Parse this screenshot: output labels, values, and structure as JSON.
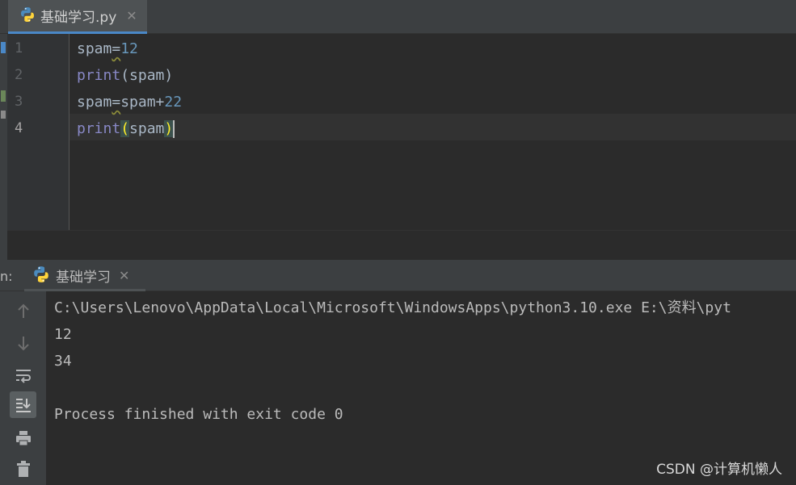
{
  "editor": {
    "tab": {
      "label": "基础学习.py",
      "close": "✕"
    },
    "line_numbers": [
      "1",
      "2",
      "3",
      "4"
    ],
    "lines": [
      [
        {
          "t": "name",
          "v": "spam"
        },
        {
          "t": "op",
          "v": "="
        },
        {
          "t": "num",
          "v": "12"
        }
      ],
      [
        {
          "t": "builtin",
          "v": "print"
        },
        {
          "t": "paren",
          "v": "("
        },
        {
          "t": "name",
          "v": "spam"
        },
        {
          "t": "paren",
          "v": ")"
        }
      ],
      [
        {
          "t": "name",
          "v": "spam"
        },
        {
          "t": "op",
          "v": "="
        },
        {
          "t": "name",
          "v": "spam+"
        },
        {
          "t": "num",
          "v": "22"
        }
      ],
      [
        {
          "t": "builtin",
          "v": "print"
        },
        {
          "t": "paren-hl",
          "v": "("
        },
        {
          "t": "name",
          "v": "spam"
        },
        {
          "t": "paren-hl",
          "v": ")"
        },
        {
          "t": "caret",
          "v": ""
        }
      ]
    ],
    "current_line": 4
  },
  "run": {
    "prefix": "n:",
    "tab": {
      "label": "基础学习",
      "close": "✕"
    },
    "tools": [
      "up-arrow-icon",
      "down-arrow-icon",
      "soft-wrap-icon",
      "scroll-to-end-icon",
      "print-icon",
      "trash-icon"
    ],
    "active_tool": "scroll-to-end-icon",
    "console_lines": [
      "C:\\Users\\Lenovo\\AppData\\Local\\Microsoft\\WindowsApps\\python3.10.exe E:\\资料\\pyt",
      "12",
      "34",
      "",
      "Process finished with exit code 0"
    ]
  },
  "watermark": "CSDN @计算机懒人",
  "colors": {
    "background": "#2b2b2b",
    "panel": "#3c3f41",
    "tab_accent": "#4a88c7",
    "keyword_builtin": "#8888c6",
    "number": "#6897bb",
    "text": "#a9b7c6",
    "brace_highlight": "#ffef28"
  }
}
